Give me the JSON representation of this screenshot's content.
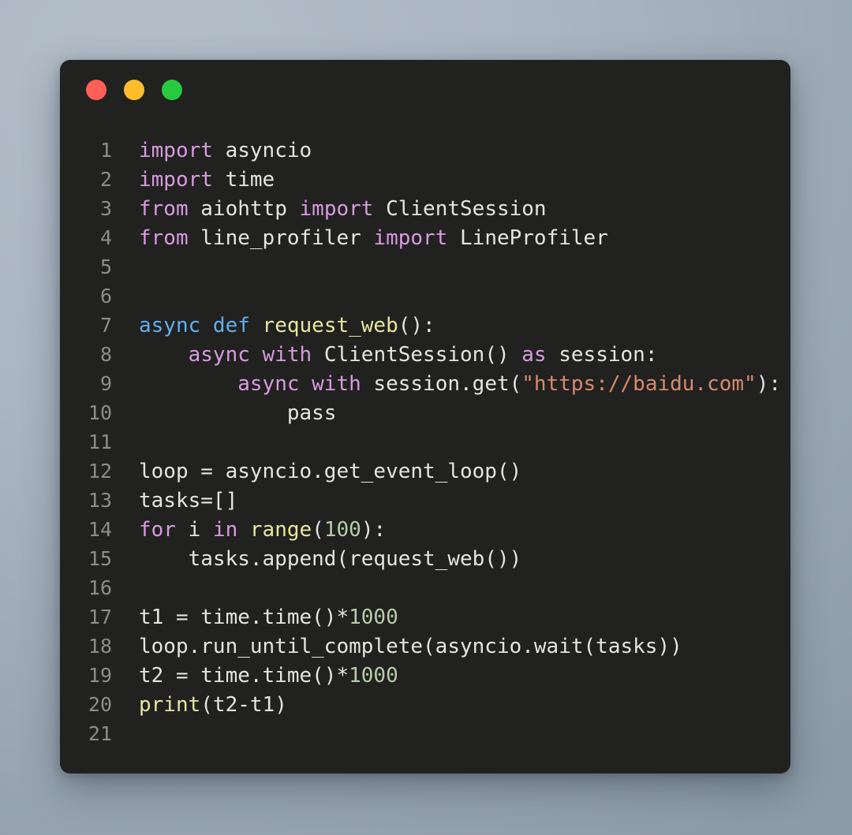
{
  "window": {
    "background_color": "#21211f",
    "page_background_color": "#a8b4c0",
    "traffic_lights": [
      {
        "name": "close",
        "color": "#ff5f56"
      },
      {
        "name": "minimize",
        "color": "#ffbd2e"
      },
      {
        "name": "maximize",
        "color": "#27c93f"
      }
    ]
  },
  "editor": {
    "language": "python",
    "lineno_color": "#8c8c8c",
    "token_colors": {
      "keyword": "#d89ae0",
      "keyword_def": "#61afef",
      "function": "#e6e6a1",
      "string": "#d9896c",
      "number": "#b5cea8",
      "plain": "#e4e4e4"
    },
    "lines": [
      {
        "n": "1",
        "tokens": [
          {
            "t": "import",
            "c": "kw"
          },
          {
            "t": " asyncio",
            "c": "plain"
          }
        ]
      },
      {
        "n": "2",
        "tokens": [
          {
            "t": "import",
            "c": "kw"
          },
          {
            "t": " time",
            "c": "plain"
          }
        ]
      },
      {
        "n": "3",
        "tokens": [
          {
            "t": "from",
            "c": "kw"
          },
          {
            "t": " aiohttp ",
            "c": "plain"
          },
          {
            "t": "import",
            "c": "kw"
          },
          {
            "t": " ClientSession",
            "c": "plain"
          }
        ]
      },
      {
        "n": "4",
        "tokens": [
          {
            "t": "from",
            "c": "kw"
          },
          {
            "t": " line_profiler ",
            "c": "plain"
          },
          {
            "t": "import",
            "c": "kw"
          },
          {
            "t": " LineProfiler",
            "c": "plain"
          }
        ]
      },
      {
        "n": "5",
        "tokens": []
      },
      {
        "n": "6",
        "tokens": []
      },
      {
        "n": "7",
        "tokens": [
          {
            "t": "async def",
            "c": "kw2"
          },
          {
            "t": " ",
            "c": "plain"
          },
          {
            "t": "request_web",
            "c": "fn"
          },
          {
            "t": "():",
            "c": "plain"
          }
        ]
      },
      {
        "n": "8",
        "tokens": [
          {
            "t": "    ",
            "c": "plain"
          },
          {
            "t": "async with",
            "c": "kw"
          },
          {
            "t": " ClientSession() ",
            "c": "plain"
          },
          {
            "t": "as",
            "c": "kw"
          },
          {
            "t": " session:",
            "c": "plain"
          }
        ]
      },
      {
        "n": "9",
        "tokens": [
          {
            "t": "        ",
            "c": "plain"
          },
          {
            "t": "async with",
            "c": "kw"
          },
          {
            "t": " session.get(",
            "c": "plain"
          },
          {
            "t": "\"https://baidu.com\"",
            "c": "str"
          },
          {
            "t": "):",
            "c": "plain"
          }
        ]
      },
      {
        "n": "10",
        "tokens": [
          {
            "t": "            pass",
            "c": "plain"
          }
        ]
      },
      {
        "n": "11",
        "tokens": []
      },
      {
        "n": "12",
        "tokens": [
          {
            "t": "loop = asyncio.get_event_loop()",
            "c": "plain"
          }
        ]
      },
      {
        "n": "13",
        "tokens": [
          {
            "t": "tasks=[]",
            "c": "plain"
          }
        ]
      },
      {
        "n": "14",
        "tokens": [
          {
            "t": "for",
            "c": "kw"
          },
          {
            "t": " i ",
            "c": "plain"
          },
          {
            "t": "in",
            "c": "kw"
          },
          {
            "t": " ",
            "c": "plain"
          },
          {
            "t": "range",
            "c": "fn"
          },
          {
            "t": "(",
            "c": "plain"
          },
          {
            "t": "100",
            "c": "num"
          },
          {
            "t": "):",
            "c": "plain"
          }
        ]
      },
      {
        "n": "15",
        "tokens": [
          {
            "t": "    tasks.append(request_web())",
            "c": "plain"
          }
        ]
      },
      {
        "n": "16",
        "tokens": []
      },
      {
        "n": "17",
        "tokens": [
          {
            "t": "t1 = time.time()*",
            "c": "plain"
          },
          {
            "t": "1000",
            "c": "num"
          }
        ]
      },
      {
        "n": "18",
        "tokens": [
          {
            "t": "loop.run_until_complete(asyncio.wait(tasks))",
            "c": "plain"
          }
        ]
      },
      {
        "n": "19",
        "tokens": [
          {
            "t": "t2 = time.time()*",
            "c": "plain"
          },
          {
            "t": "1000",
            "c": "num"
          }
        ]
      },
      {
        "n": "20",
        "tokens": [
          {
            "t": "print",
            "c": "fn"
          },
          {
            "t": "(t2-t1)",
            "c": "plain"
          }
        ]
      },
      {
        "n": "21",
        "tokens": []
      }
    ]
  }
}
